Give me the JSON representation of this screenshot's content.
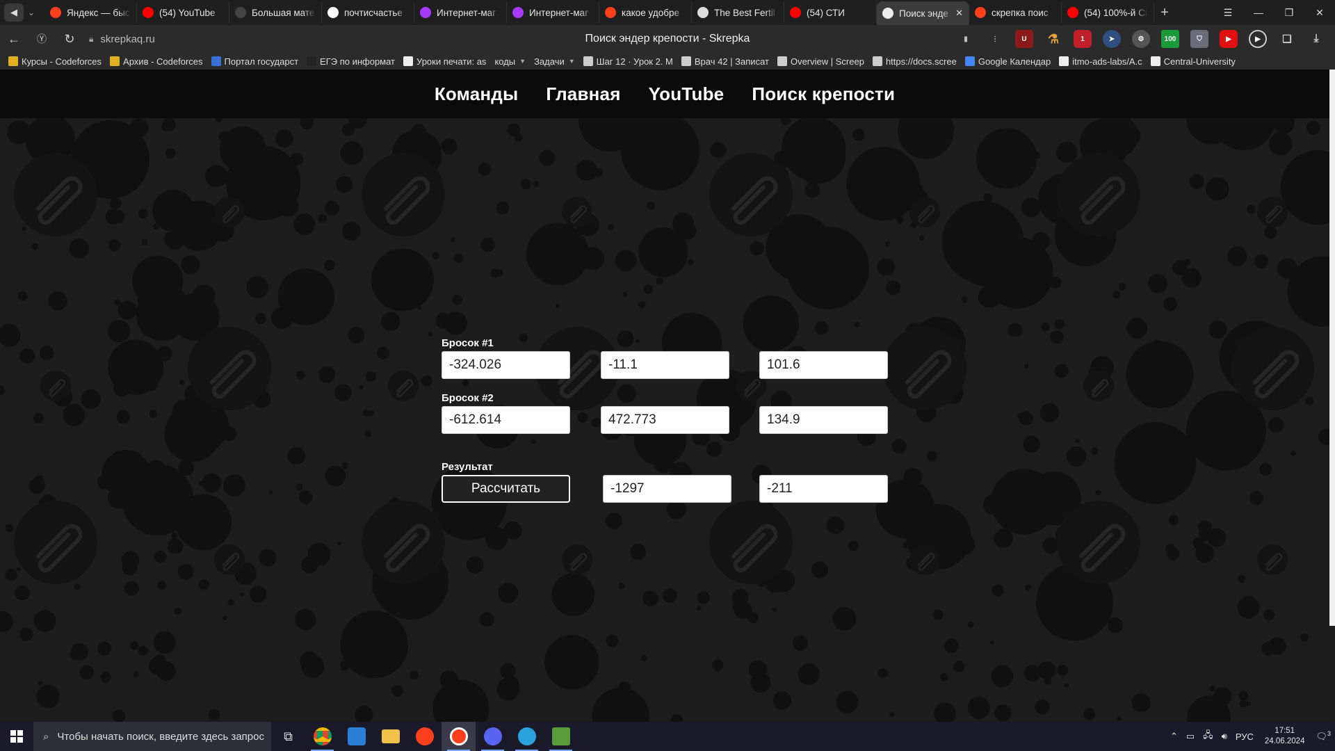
{
  "browser": {
    "tabs": [
      {
        "label": "Яндекс — быс",
        "favicon": "yandex-icon",
        "color": "#fc3f1d"
      },
      {
        "label": "(54) YouTube",
        "favicon": "youtube-icon",
        "color": "#ff0000"
      },
      {
        "label": "Большая мате",
        "favicon": "notion-icon",
        "color": "#444444"
      },
      {
        "label": "почтисчастье",
        "favicon": "book-icon",
        "color": "#ffffff"
      },
      {
        "label": "Интернет-маг",
        "favicon": "wildberries-icon",
        "color": "#a73afd"
      },
      {
        "label": "Интернет-маг",
        "favicon": "wildberries-icon",
        "color": "#a73afd"
      },
      {
        "label": "какое удобре",
        "favicon": "yandex-icon",
        "color": "#fc3f1d"
      },
      {
        "label": "The Best Fertil",
        "favicon": "mask-icon",
        "color": "#dddddd"
      },
      {
        "label": "(54) СТИ",
        "favicon": "youtube-icon",
        "color": "#ff0000"
      },
      {
        "label": "Поиск энде",
        "favicon": "skrepka-icon",
        "color": "#eeeeee",
        "active": true
      },
      {
        "label": "скрепка поис",
        "favicon": "yandex-icon",
        "color": "#fc3f1d"
      },
      {
        "label": "(54) 100%-й Сі",
        "favicon": "youtube-icon",
        "color": "#ff0000"
      }
    ],
    "url": "skrepkaq.ru",
    "page_title": "Поиск эндер крепости - Skrepka",
    "bookmarks": [
      {
        "label": "Курсы - Codeforces",
        "color": "#e0b020"
      },
      {
        "label": "Архив - Codeforces",
        "color": "#e0b020"
      },
      {
        "label": "Портал государст",
        "color": "#3a6fd8"
      },
      {
        "label": "ЕГЭ по информат",
        "color": "#222222"
      },
      {
        "label": "Уроки печати: as",
        "color": "#eeeeee"
      },
      {
        "label": "коды",
        "color": "",
        "dropdown": true
      },
      {
        "label": "Задачи",
        "color": "",
        "dropdown": true
      },
      {
        "label": "Шаг 12 · Урок 2. М",
        "color": "#cccccc"
      },
      {
        "label": "Врач 42 | Записат",
        "color": "#cccccc"
      },
      {
        "label": "Overview | Screep",
        "color": "#cccccc"
      },
      {
        "label": "https://docs.scree",
        "color": "#cccccc"
      },
      {
        "label": "Google Календар",
        "color": "#4285f4"
      },
      {
        "label": "itmo-ads-labs/A.c",
        "color": "#eeeeee"
      },
      {
        "label": "Central-University",
        "color": "#eeeeee"
      }
    ]
  },
  "site": {
    "nav": [
      "Команды",
      "Главная",
      "YouTube",
      "Поиск крепости"
    ],
    "throw1": {
      "label": "Бросок #1",
      "x": "-324.026",
      "y": "-11.1",
      "angle": "101.6"
    },
    "throw2": {
      "label": "Бросок #2",
      "x": "-612.614",
      "y": "472.773",
      "angle": "134.9"
    },
    "result": {
      "label": "Результат",
      "button": "Рассчитать",
      "x": "-1297",
      "z": "-211"
    }
  },
  "taskbar": {
    "search_placeholder": "Чтобы начать поиск, введите здесь запрос",
    "language": "РУС",
    "time": "17:51",
    "date": "24.06.2024",
    "notifications": "3"
  }
}
